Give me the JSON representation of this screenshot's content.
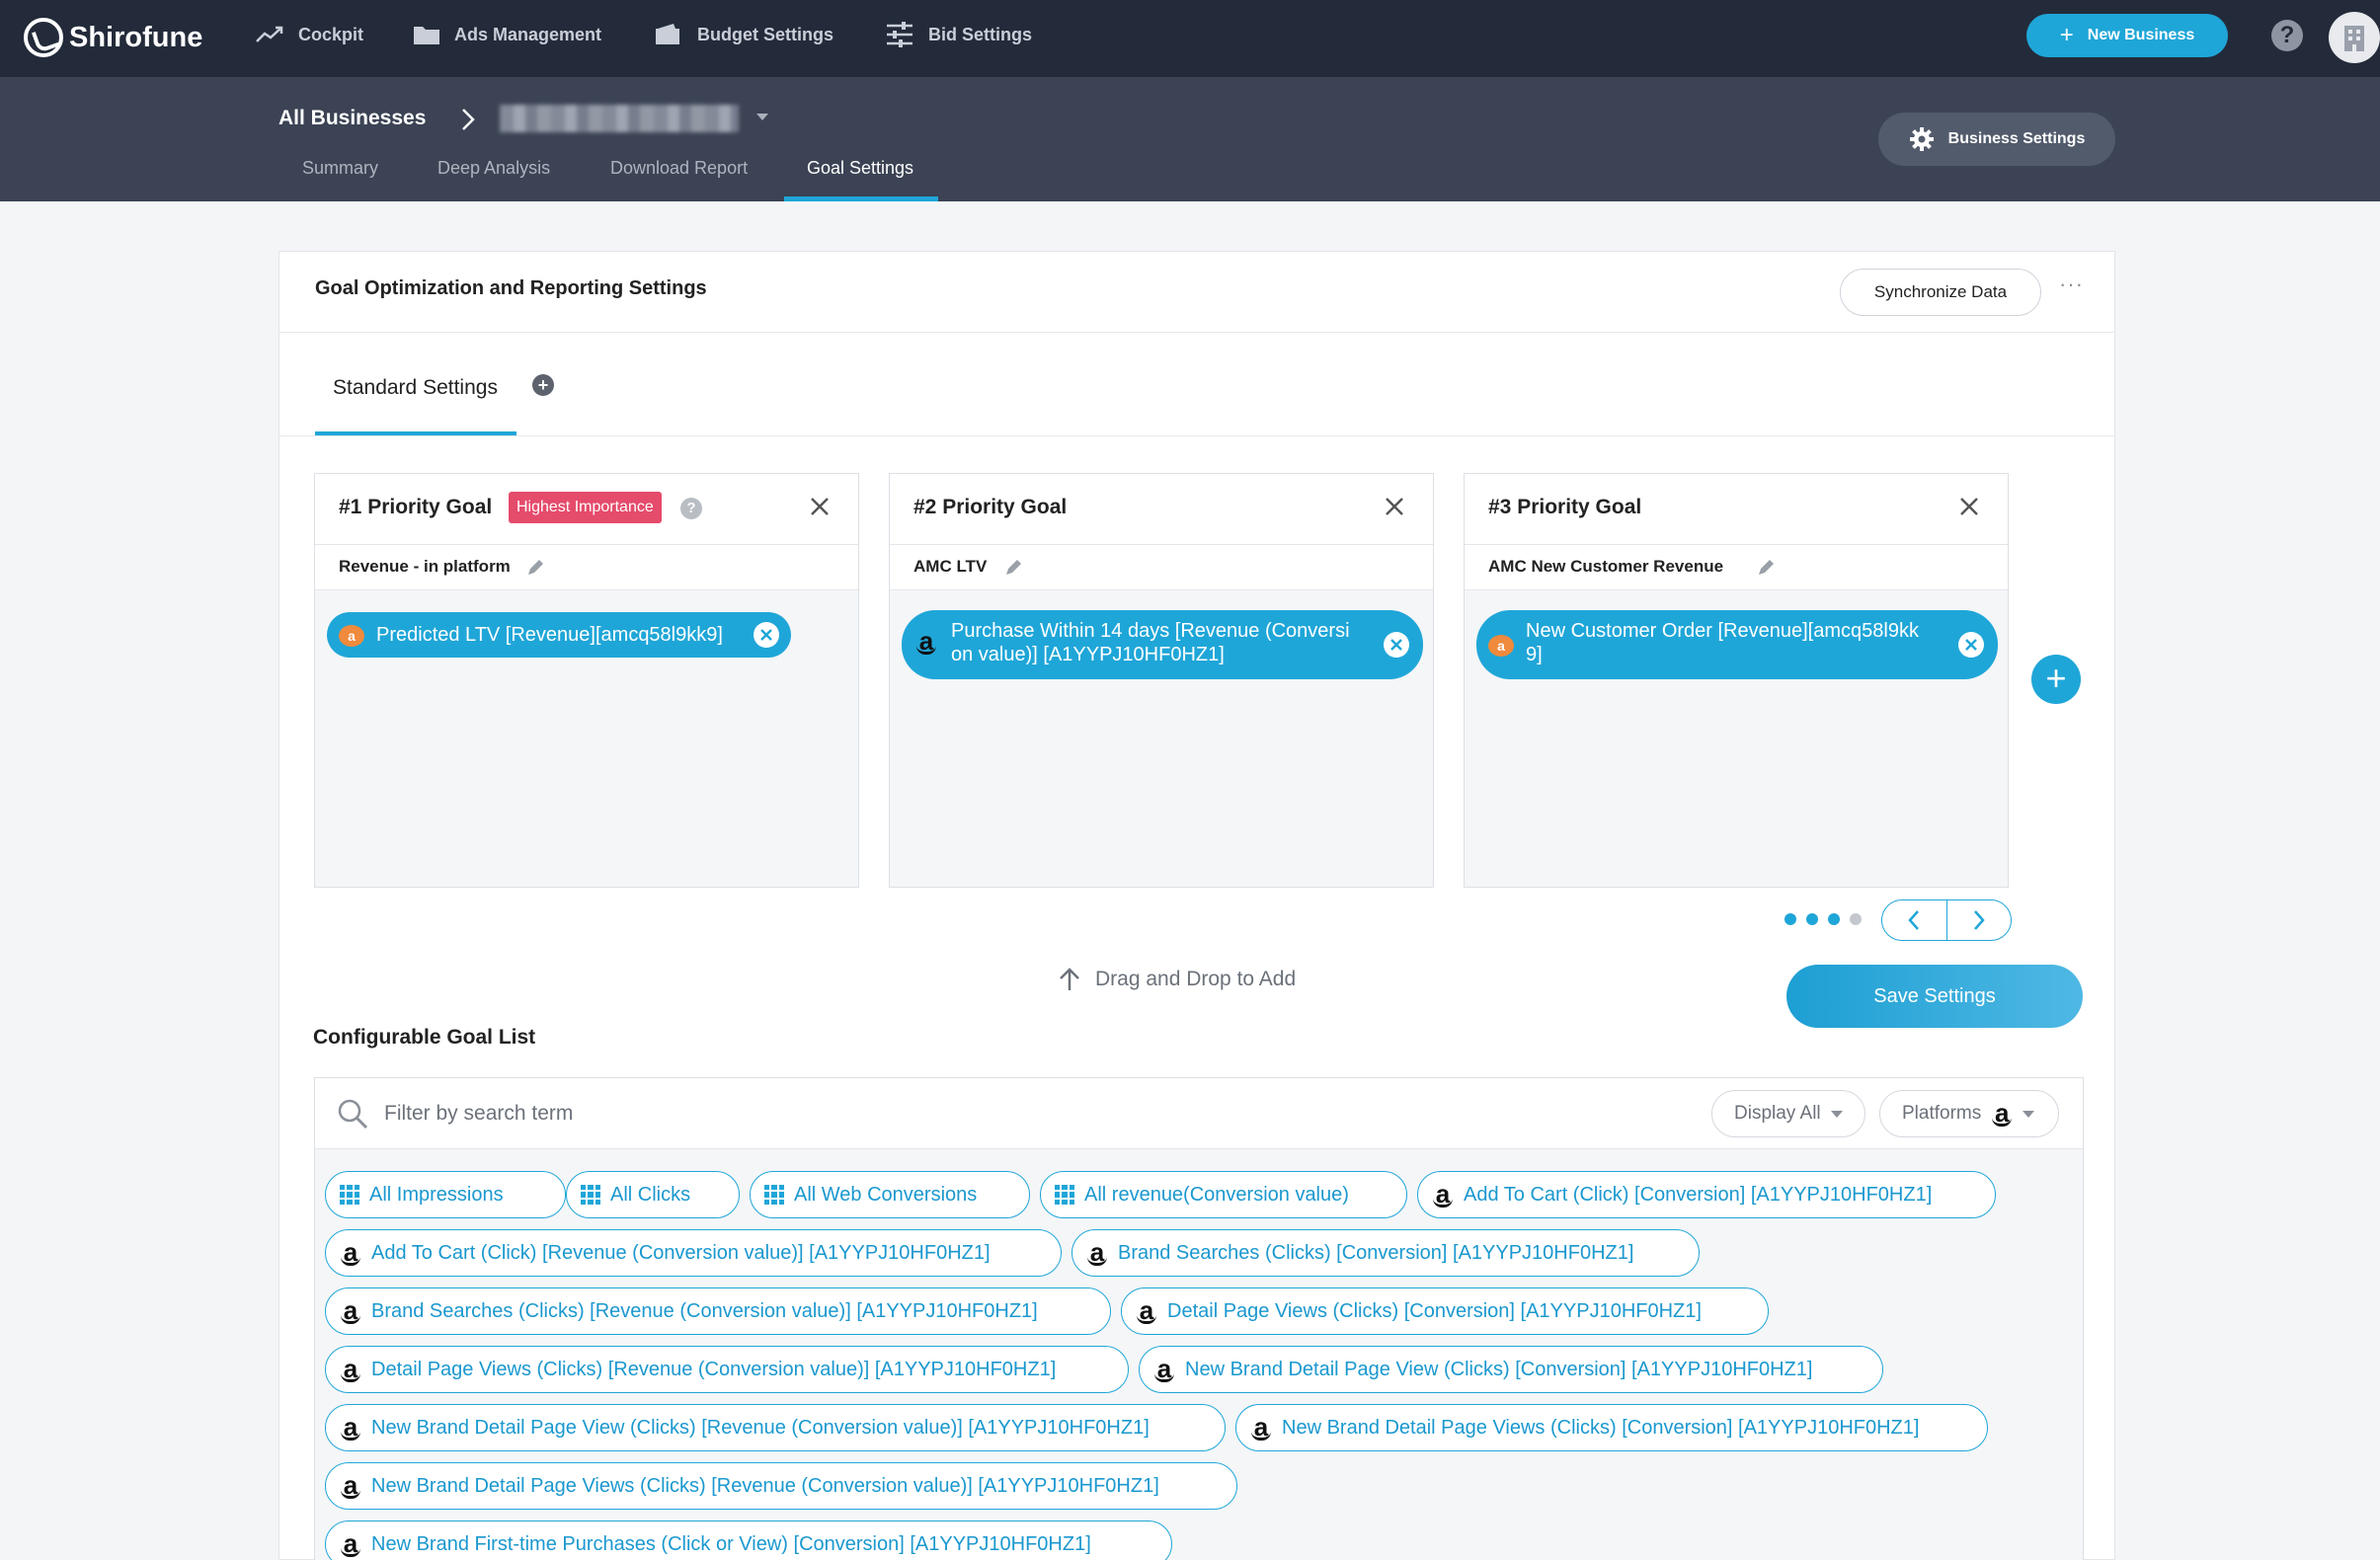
{
  "app": {
    "name": "Shirofune"
  },
  "topnav": {
    "items": [
      {
        "label": "Cockpit",
        "icon": "trend-icon"
      },
      {
        "label": "Ads Management",
        "icon": "folder-icon"
      },
      {
        "label": "Budget Settings",
        "icon": "wallet-icon"
      },
      {
        "label": "Bid Settings",
        "icon": "sliders-icon"
      }
    ],
    "new_business": "New Business",
    "help": "?"
  },
  "breadcrumb": {
    "root": "All Businesses"
  },
  "tabs": [
    "Summary",
    "Deep Analysis",
    "Download Report",
    "Goal Settings"
  ],
  "active_tab": "Goal Settings",
  "business_settings": "Business Settings",
  "panel": {
    "title": "Goal Optimization and Reporting Settings",
    "sync_button": "Synchronize Data",
    "more": "···",
    "settings_tab": "Standard Settings",
    "add_tab": "+"
  },
  "goals": [
    {
      "title": "#1 Priority Goal",
      "badge": "Highest Importance",
      "badge_help": "?",
      "name": "Revenue - in platform",
      "pill": "Predicted LTV [Revenue][amcq58l9kk9]",
      "pill_icon": "amc-icon"
    },
    {
      "title": "#2 Priority Goal",
      "name": "AMC LTV",
      "pill_line1": "Purchase Within 14 days [Revenue (Conversi",
      "pill_line2": "on value)] [A1YYPJ10HF0HZ1]",
      "pill_icon": "amazon-icon"
    },
    {
      "title": "#3 Priority Goal",
      "name": "AMC New Customer Revenue",
      "pill_line1": "New Customer Order [Revenue][amcq58l9kk",
      "pill_line2": "9]",
      "pill_icon": "amc-icon"
    }
  ],
  "pagination": {
    "pages": 4,
    "current": 3
  },
  "drag_hint": "Drag and Drop to Add",
  "save_button": "Save Settings",
  "configurable": {
    "title": "Configurable Goal List",
    "search_placeholder": "Filter by search term",
    "display_dropdown": "Display All",
    "platforms_dropdown": "Platforms",
    "chips": [
      {
        "label": "All Impressions",
        "icon": "grid-icon"
      },
      {
        "label": "All Clicks",
        "icon": "grid-icon"
      },
      {
        "label": "All Web Conversions",
        "icon": "grid-icon"
      },
      {
        "label": "All revenue(Conversion value)",
        "icon": "grid-icon"
      },
      {
        "label": "Add To Cart (Click) [Conversion] [A1YYPJ10HF0HZ1]",
        "icon": "amazon-icon"
      },
      {
        "label": "Add To Cart (Click) [Revenue (Conversion value)] [A1YYPJ10HF0HZ1]",
        "icon": "amazon-icon"
      },
      {
        "label": "Brand Searches (Clicks) [Conversion] [A1YYPJ10HF0HZ1]",
        "icon": "amazon-icon"
      },
      {
        "label": "Brand Searches (Clicks) [Revenue (Conversion value)] [A1YYPJ10HF0HZ1]",
        "icon": "amazon-icon"
      },
      {
        "label": "Detail Page Views (Clicks) [Conversion] [A1YYPJ10HF0HZ1]",
        "icon": "amazon-icon"
      },
      {
        "label": "Detail Page Views (Clicks) [Revenue (Conversion value)] [A1YYPJ10HF0HZ1]",
        "icon": "amazon-icon"
      },
      {
        "label": "New Brand Detail Page View (Clicks) [Conversion] [A1YYPJ10HF0HZ1]",
        "icon": "amazon-icon"
      },
      {
        "label": "New Brand Detail Page View (Clicks) [Revenue (Conversion value)] [A1YYPJ10HF0HZ1]",
        "icon": "amazon-icon"
      },
      {
        "label": "New Brand Detail Page Views (Clicks) [Conversion] [A1YYPJ10HF0HZ1]",
        "icon": "amazon-icon"
      },
      {
        "label": "New Brand Detail Page Views (Clicks) [Revenue (Conversion value)] [A1YYPJ10HF0HZ1]",
        "icon": "amazon-icon"
      },
      {
        "label": "New Brand First-time Purchases (Click or View) [Conversion] [A1YYPJ10HF0HZ1]",
        "icon": "amazon-icon"
      }
    ]
  },
  "colors": {
    "accent": "#1fa6d8",
    "topbar": "#232b3a",
    "subbar": "#3b4354",
    "badge": "#e54b6b"
  }
}
